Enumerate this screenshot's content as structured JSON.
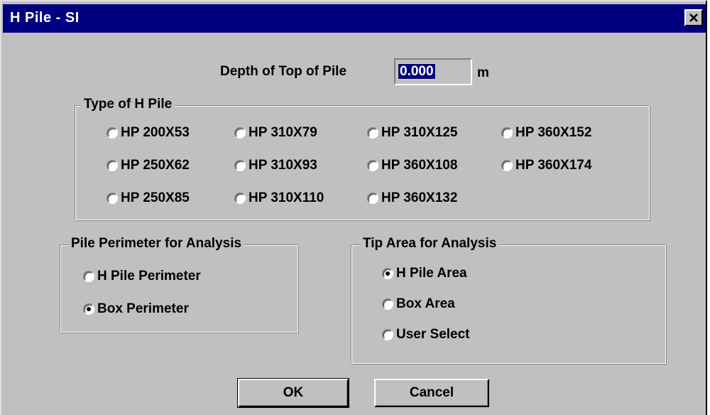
{
  "window": {
    "title": "H Pile - SI",
    "close_icon": "close-x-icon"
  },
  "depth": {
    "label": "Depth of Top of Pile",
    "value": "0.000",
    "unit": "m"
  },
  "type_group": {
    "legend": "Type of H Pile",
    "options": [
      {
        "label": "HP 200X53",
        "selected": false
      },
      {
        "label": "HP 310X79",
        "selected": false
      },
      {
        "label": "HP 310X125",
        "selected": false
      },
      {
        "label": "HP 360X152",
        "selected": false
      },
      {
        "label": "HP 250X62",
        "selected": false
      },
      {
        "label": "HP 310X93",
        "selected": false
      },
      {
        "label": "HP 360X108",
        "selected": false
      },
      {
        "label": "HP 360X174",
        "selected": false
      },
      {
        "label": "HP 250X85",
        "selected": false
      },
      {
        "label": "HP 310X110",
        "selected": false
      },
      {
        "label": "HP 360X132",
        "selected": false
      }
    ]
  },
  "perimeter_group": {
    "legend": "Pile Perimeter for Analysis",
    "options": [
      {
        "label": "H Pile Perimeter",
        "selected": false
      },
      {
        "label": "Box Perimeter",
        "selected": true
      }
    ]
  },
  "tip_group": {
    "legend": "Tip Area for Analysis",
    "options": [
      {
        "label": "H Pile Area",
        "selected": true
      },
      {
        "label": "Box Area",
        "selected": false
      },
      {
        "label": "User Select",
        "selected": false
      }
    ]
  },
  "buttons": {
    "ok": "OK",
    "cancel": "Cancel"
  },
  "colors": {
    "titlebar": "#000080",
    "face": "#c0c0c0"
  }
}
